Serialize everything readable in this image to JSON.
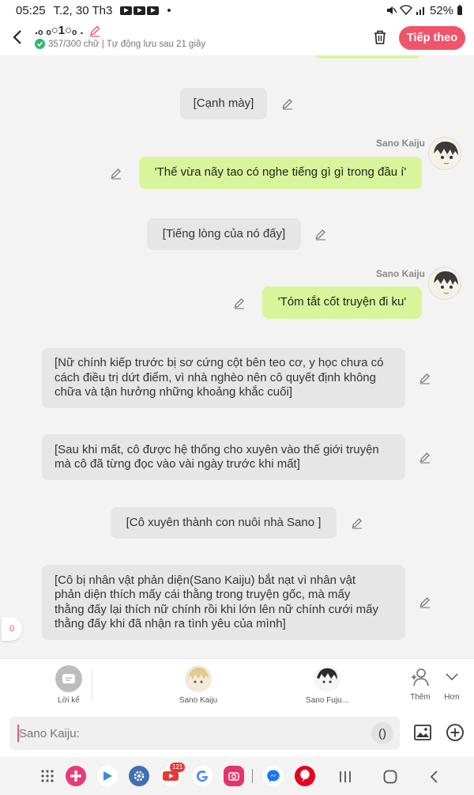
{
  "status_bar": {
    "time": "05:25",
    "date": "T.2, 30 Th3",
    "battery": "52%"
  },
  "header": {
    "title": ".ₒ ₒ○1○ₒ .",
    "subtitle": "357/300 chữ | Tự động lưu sau 21 giây",
    "next_label": "Tiếp theo"
  },
  "messages": [
    {
      "type": "narration",
      "text": "[Cạnh mày]"
    },
    {
      "type": "character",
      "sender": "Sano Kaiju",
      "text": "'Thế vừa nãy tao có nghe tiếng gì gì trong đầu í'"
    },
    {
      "type": "narration",
      "text": "[Tiếng lòng của nó đấy]"
    },
    {
      "type": "character",
      "sender": "Sano Kaiju",
      "text": "'Tóm tắt cốt truyện đi ku'"
    },
    {
      "type": "narration",
      "lines": [
        "[Nữ chính kiếp trước bị sơ cứng cột bên teo cơ, y học chưa có",
        "cách điều trị dứt điểm, vì nhà nghèo nên cô quyết định không",
        "chữa và tận hưởng những khoảng khắc cuối]"
      ]
    },
    {
      "type": "narration",
      "lines": [
        "[Sau khi mất, cô được hệ thống cho xuyên vào thế giới truyện",
        "mà cô đã từng đọc vào vài ngày trước khi mất]"
      ]
    },
    {
      "type": "narration",
      "text": "[Cô xuyên thành con nuôi nhà Sano ]"
    },
    {
      "type": "narration",
      "lines": [
        "[Cô bị nhân vật phản diện(Sano Kaiju) bắt nạt vì nhân vật",
        "phản diện thích mấy cái thằng trong truyện gốc, mà mấy",
        "thằng đấy lại thích nữ chính rồi khi lớn lên nữ chính cưới mấy",
        "thằng đấy khi đã nhận ra tình yêu của mình]"
      ]
    }
  ],
  "counter": "0",
  "characters": [
    {
      "label": "Lời kể"
    },
    {
      "label": "Sano Kaiju"
    },
    {
      "label": "Sano Fuju..."
    },
    {
      "label": "Thêm"
    },
    {
      "label": "Hơn"
    }
  ],
  "input": {
    "placeholder": "Sano Kaiju:",
    "paren_label": "()"
  },
  "navbar": {
    "badge": "121"
  },
  "colors": {
    "accent": "#f0546b",
    "my_bubble": "#d9f59b",
    "narration_bubble": "#e6e6e6"
  }
}
